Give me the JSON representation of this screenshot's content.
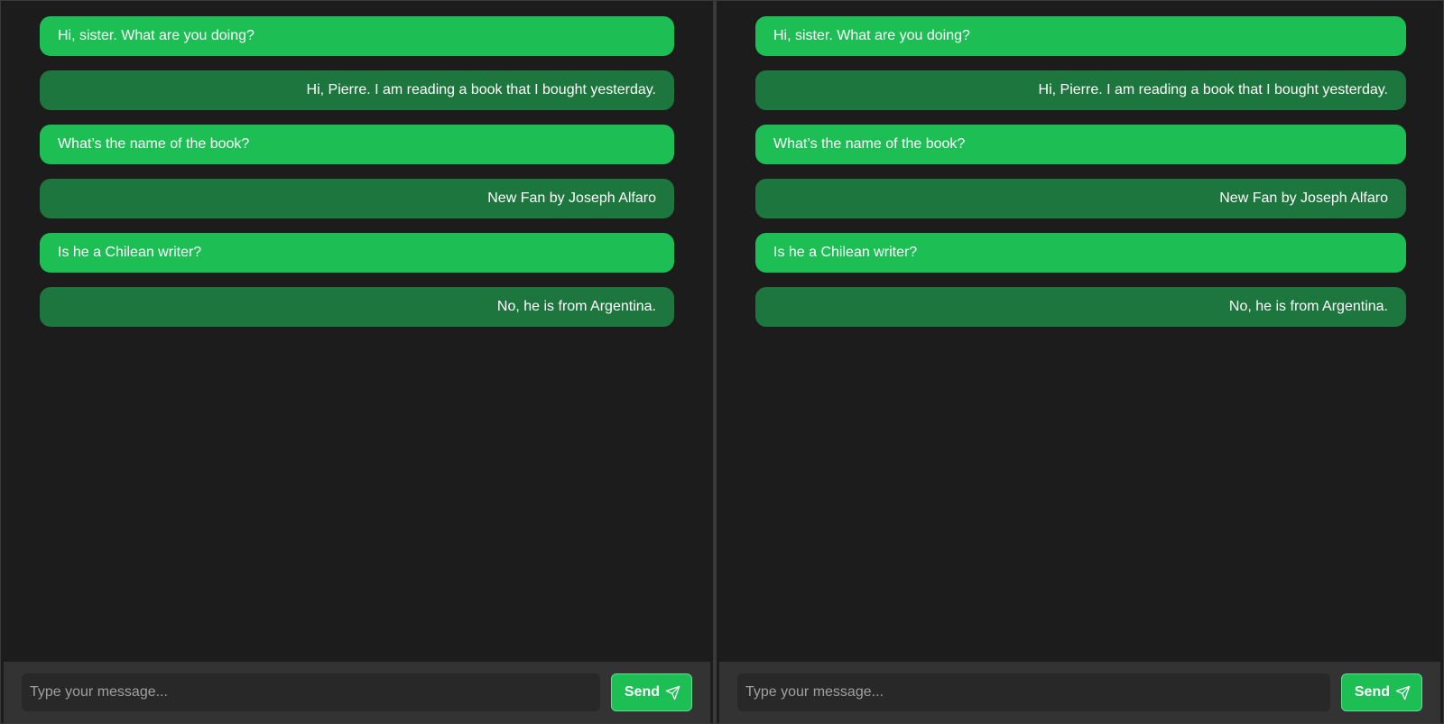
{
  "colors": {
    "sent_bubble": "#1dbf55",
    "received_bubble": "#1d763d",
    "panel_bg": "#1c1c1c",
    "composer_bg": "#333333",
    "input_bg": "#282828"
  },
  "panels": [
    {
      "messages": [
        {
          "side": "sent",
          "text": "Hi, sister. What are you doing?"
        },
        {
          "side": "received",
          "text": "Hi, Pierre. I am reading a book that I bought yesterday."
        },
        {
          "side": "sent",
          "text": "What’s the name of the book?"
        },
        {
          "side": "received",
          "text": "New Fan by Joseph Alfaro"
        },
        {
          "side": "sent",
          "text": "Is he a Chilean writer?"
        },
        {
          "side": "received",
          "text": "No, he is from Argentina."
        }
      ],
      "composer": {
        "placeholder": "Type your message...",
        "send_label": "Send",
        "send_icon": "paper-plane-icon"
      }
    },
    {
      "messages": [
        {
          "side": "sent",
          "text": "Hi, sister. What are you doing?"
        },
        {
          "side": "received",
          "text": "Hi, Pierre. I am reading a book that I bought yesterday."
        },
        {
          "side": "sent",
          "text": "What’s the name of the book?"
        },
        {
          "side": "received",
          "text": "New Fan by Joseph Alfaro"
        },
        {
          "side": "sent",
          "text": "Is he a Chilean writer?"
        },
        {
          "side": "received",
          "text": "No, he is from Argentina."
        }
      ],
      "composer": {
        "placeholder": "Type your message...",
        "send_label": "Send",
        "send_icon": "paper-plane-icon"
      }
    }
  ]
}
